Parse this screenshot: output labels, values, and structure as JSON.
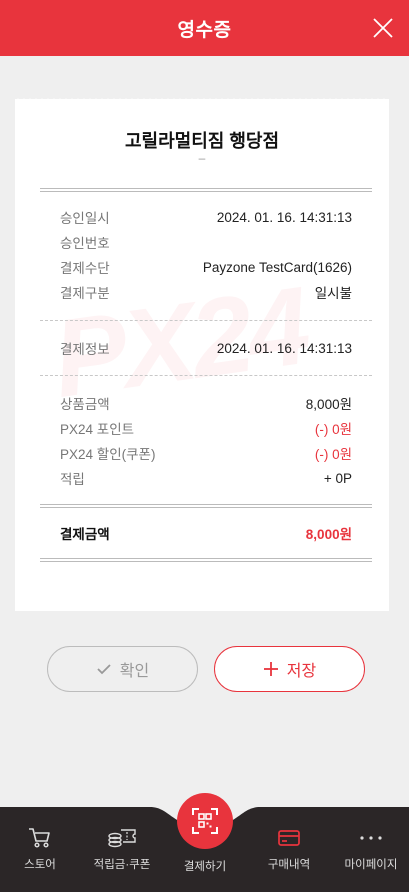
{
  "header": {
    "title": "영수증",
    "close_icon": "close-icon"
  },
  "receipt": {
    "store_name": "고릴라멀티짐 행당점",
    "store_sub": "–",
    "watermark": "PX24",
    "approval": [
      {
        "label": "승인일시",
        "value": "2024. 01. 16. 14:31:13"
      },
      {
        "label": "승인번호",
        "value": ""
      },
      {
        "label": "결제수단",
        "value": "Payzone TestCard(1626)"
      },
      {
        "label": "결제구분",
        "value": "일시불"
      }
    ],
    "payment_info": {
      "label": "결제정보",
      "value": "2024. 01. 16. 14:31:13"
    },
    "amounts": [
      {
        "label": "상품금액",
        "value": "8,000원"
      },
      {
        "label": "PX24 포인트",
        "value": "(-) 0원"
      },
      {
        "label": "PX24 할인(쿠폰)",
        "value": "(-) 0원"
      },
      {
        "label": "적립",
        "value": "+ 0P"
      }
    ],
    "total": {
      "label": "결제금액",
      "value": "8,000원"
    }
  },
  "buttons": {
    "confirm": {
      "label": "확인",
      "icon": "check-icon"
    },
    "save": {
      "label": "저장",
      "icon": "plus-icon"
    }
  },
  "tabbar": {
    "items": [
      {
        "label": "스토어",
        "icon": "cart-icon"
      },
      {
        "label": "적립금·쿠폰",
        "icon": "coupon-icon"
      },
      {
        "label": "결제하기",
        "icon": "qr-scan-icon"
      },
      {
        "label": "구매내역",
        "icon": "card-icon"
      },
      {
        "label": "마이페이지",
        "icon": "more-icon"
      }
    ],
    "active_index": 3
  },
  "colors": {
    "accent": "#e8343d",
    "background": "#efefef",
    "tabbar": "#2b2627"
  }
}
